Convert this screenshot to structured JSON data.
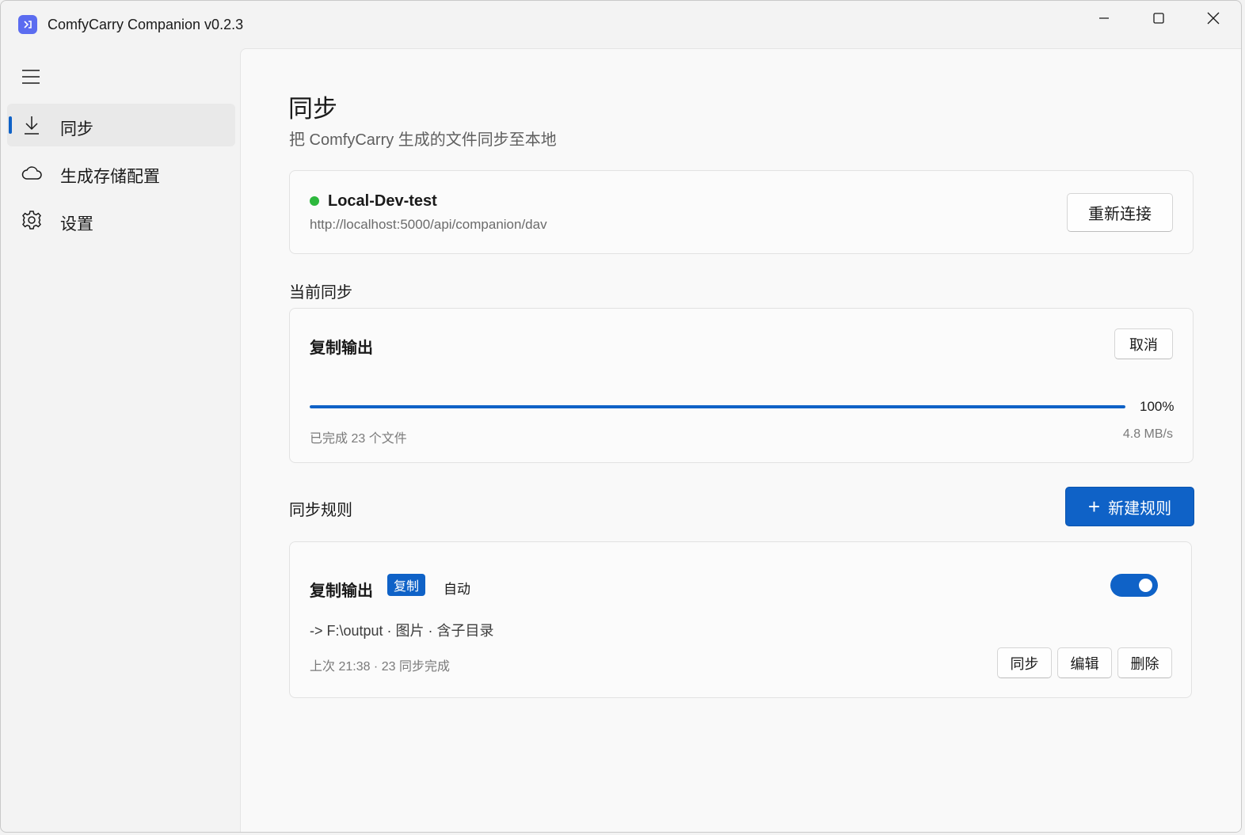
{
  "window": {
    "title": "ComfyCarry Companion v0.2.3"
  },
  "sidebar": {
    "items": [
      {
        "label": "同步",
        "icon": "download-icon",
        "active": true
      },
      {
        "label": "生成存储配置",
        "icon": "cloud-icon",
        "active": false
      },
      {
        "label": "设置",
        "icon": "gear-icon",
        "active": false
      }
    ]
  },
  "page": {
    "title": "同步",
    "subtitle": "把 ComfyCarry 生成的文件同步至本地"
  },
  "server": {
    "name": "Local-Dev-test",
    "url": "http://localhost:5000/api/companion/dav",
    "status_color": "#2db83d",
    "reconnect_label": "重新连接"
  },
  "current_sync": {
    "section_title": "当前同步",
    "task_name": "复制输出",
    "cancel_label": "取消",
    "progress": 1.0,
    "progress_label": "100%",
    "done_text": "已完成 23 个文件",
    "speed": "4.8 MB/s"
  },
  "rules": {
    "section_title": "同步规则",
    "new_rule_label": "新建规则",
    "items": [
      {
        "name": "复制输出",
        "mode_badge": "复制",
        "trigger": "自动",
        "enabled": true,
        "path": "-> F:\\output · 图片 · 含子目录",
        "last": "上次 21:38 · 23 同步完成",
        "sync_label": "同步",
        "edit_label": "编辑",
        "delete_label": "删除"
      }
    ]
  },
  "colors": {
    "accent": "#0f62c7"
  }
}
